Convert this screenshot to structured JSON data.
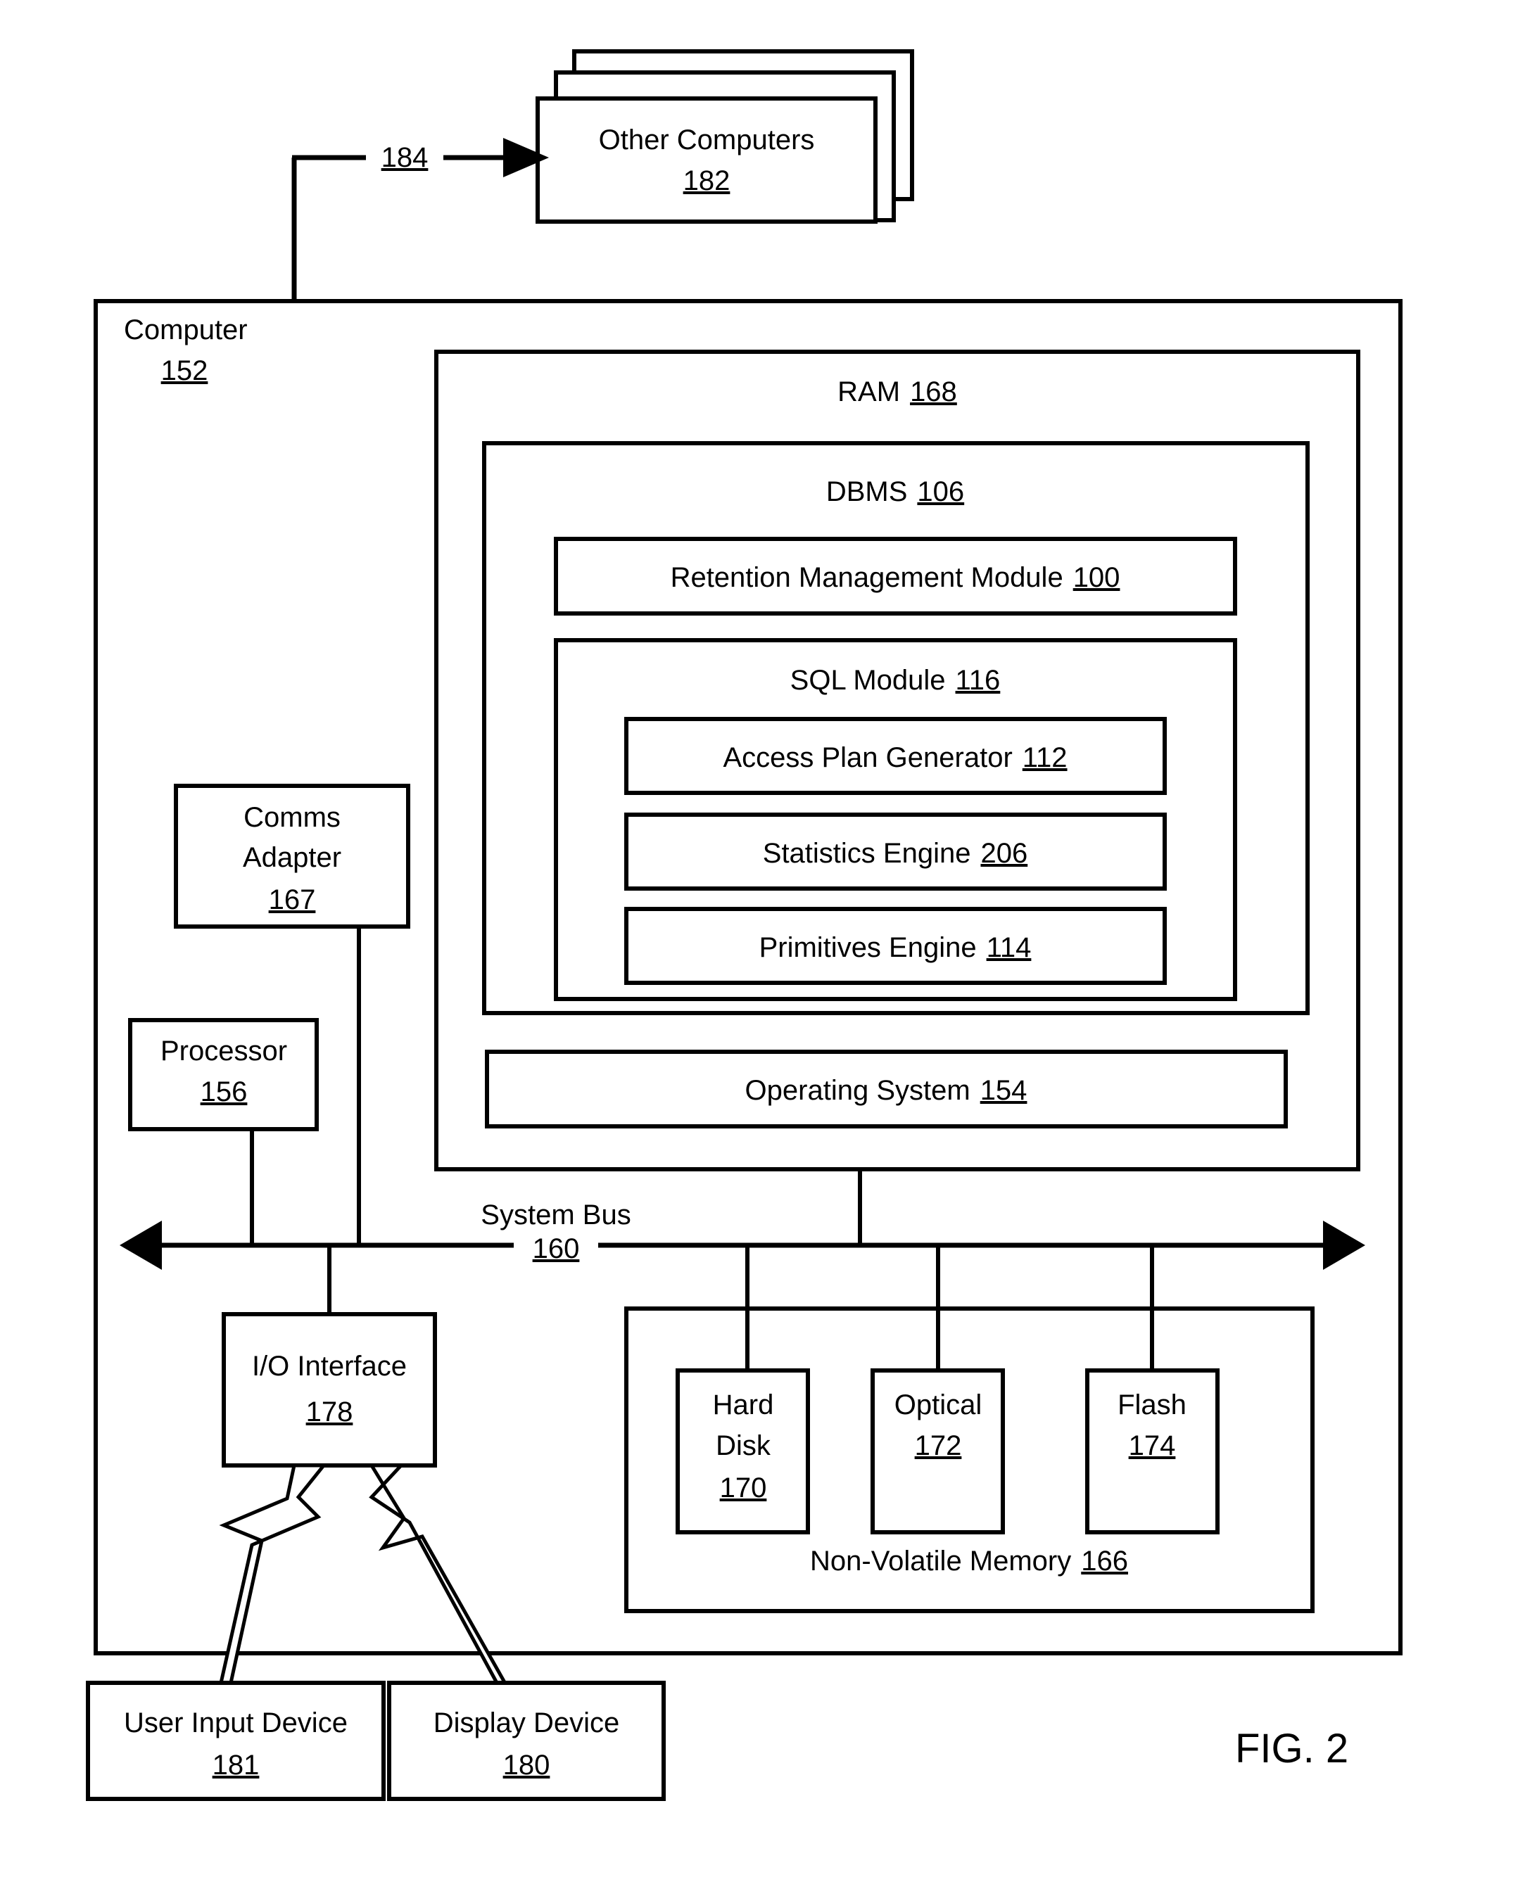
{
  "figure": {
    "caption": "FIG. 2"
  },
  "nodes": {
    "other_computers": {
      "label": "Other Computers",
      "ref": "182"
    },
    "network_link": {
      "ref": "184"
    },
    "computer": {
      "label": "Computer",
      "ref": "152"
    },
    "ram": {
      "label": "RAM",
      "ref": "168"
    },
    "dbms": {
      "label": "DBMS",
      "ref": "106"
    },
    "retention_management_module": {
      "label": "Retention Management Module",
      "ref": "100"
    },
    "sql_module": {
      "label": "SQL Module",
      "ref": "116"
    },
    "access_plan_generator": {
      "label": "Access Plan Generator",
      "ref": "112"
    },
    "statistics_engine": {
      "label": "Statistics Engine",
      "ref": "206"
    },
    "primitives_engine": {
      "label": "Primitives Engine",
      "ref": "114"
    },
    "operating_system": {
      "label": "Operating System",
      "ref": "154"
    },
    "comms_adapter": {
      "label_line1": "Comms",
      "label_line2": "Adapter",
      "ref": "167"
    },
    "processor": {
      "label": "Processor",
      "ref": "156"
    },
    "system_bus": {
      "label": "System Bus",
      "ref": "160"
    },
    "io_interface": {
      "label": "I/O Interface",
      "ref": "178"
    },
    "non_volatile_memory": {
      "label": "Non-Volatile Memory",
      "ref": "166"
    },
    "hard_disk": {
      "label_line1": "Hard",
      "label_line2": "Disk",
      "ref": "170"
    },
    "optical": {
      "label": "Optical",
      "ref": "172"
    },
    "flash": {
      "label": "Flash",
      "ref": "174"
    },
    "user_input_device": {
      "label": "User Input Device",
      "ref": "181"
    },
    "display_device": {
      "label": "Display Device",
      "ref": "180"
    }
  },
  "colors": {
    "stroke": "#000000",
    "fill": "#ffffff"
  }
}
